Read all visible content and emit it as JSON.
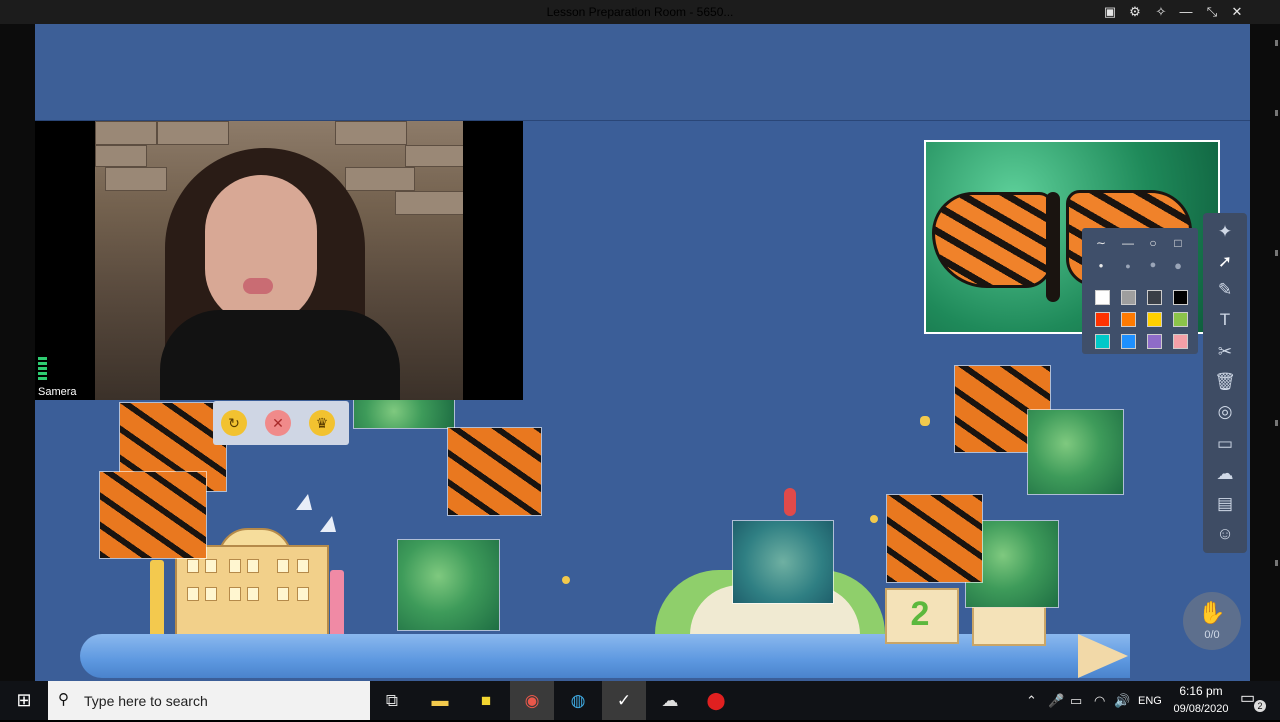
{
  "window": {
    "title": "Lesson Preparation Room - 5650..."
  },
  "video": {
    "participant_name": "Samera"
  },
  "hand_raise": {
    "count": "0/0"
  },
  "stage": {
    "cube_number": "2"
  },
  "taskbar": {
    "search_placeholder": "Type here to search",
    "time": "6:16 pm",
    "date": "09/08/2020",
    "language": "ENG",
    "notification_count": "2"
  },
  "palette": {
    "colors": [
      "#ffffff",
      "#9e9e9e",
      "#3a3f47",
      "#000000",
      "#ff3300",
      "#ff7a00",
      "#ffd000",
      "#8bc34a",
      "#00c8c8",
      "#1e90ff",
      "#8e6cc8",
      "#f4a0a8"
    ]
  }
}
